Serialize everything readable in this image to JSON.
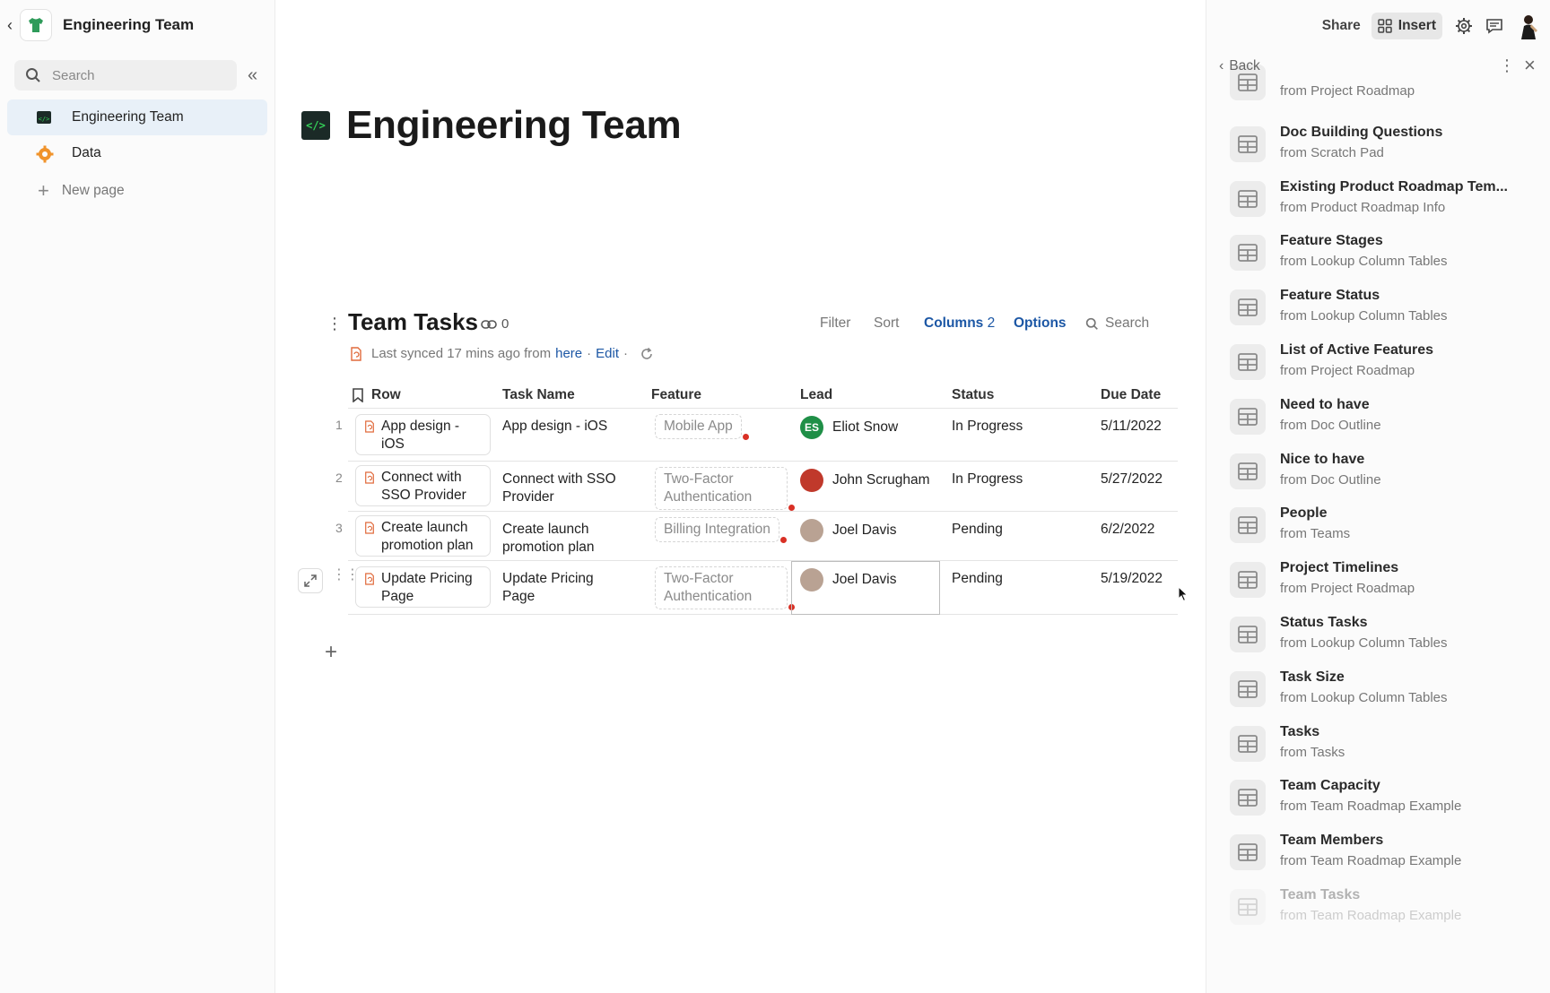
{
  "sidebar": {
    "workspace_title": "Engineering Team",
    "search_placeholder": "Search",
    "pages": [
      {
        "label": "Engineering Team",
        "icon": "code-terminal-icon",
        "active": true
      },
      {
        "label": "Data",
        "icon": "gear-icon",
        "active": false
      }
    ],
    "new_page_label": "New page"
  },
  "doc": {
    "title": "Engineering Team",
    "table": {
      "title": "Team Tasks",
      "link_count": "0",
      "toolbar": {
        "filter": "Filter",
        "sort": "Sort",
        "columns": "Columns",
        "columns_count": "2",
        "options": "Options",
        "search": "Search"
      },
      "sync": {
        "prefix": "Last synced 17 mins ago from",
        "here": "here",
        "edit": "Edit"
      },
      "columns": [
        "Row",
        "Task Name",
        "Feature",
        "Lead",
        "Status",
        "Due Date"
      ],
      "rows": [
        {
          "num": "1",
          "row": "App design - iOS",
          "task": "App design - iOS",
          "feature": "Mobile App",
          "lead": "Eliot Snow",
          "lead_initials": "ES",
          "status": "In Progress",
          "due": "5/11/2022"
        },
        {
          "num": "2",
          "row": "Connect with SSO Provider",
          "task": "Connect with SSO Provider",
          "feature": "Two-Factor Authentication",
          "lead": "John Scrugham",
          "lead_initials": "",
          "status": "In Progress",
          "due": "5/27/2022"
        },
        {
          "num": "3",
          "row": "Create launch promotion plan",
          "task": "Create launch promotion plan",
          "feature": "Billing Integration",
          "lead": "Joel Davis",
          "lead_initials": "",
          "status": "Pending",
          "due": "6/2/2022"
        },
        {
          "num": "4",
          "row": "Update Pricing Page",
          "task": "Update Pricing Page",
          "feature": "Two-Factor Authentication",
          "lead": "Joel Davis",
          "lead_initials": "",
          "status": "Pending",
          "due": "5/19/2022"
        }
      ]
    }
  },
  "topbar": {
    "share": "Share",
    "insert": "Insert"
  },
  "panel": {
    "back_label": "Back",
    "items": [
      {
        "name": "",
        "source": "from Project Roadmap"
      },
      {
        "name": "Doc Building Questions",
        "source": "from Scratch Pad"
      },
      {
        "name": "Existing Product Roadmap Tem...",
        "source": "from Product Roadmap Info"
      },
      {
        "name": "Feature Stages",
        "source": "from Lookup Column Tables"
      },
      {
        "name": "Feature Status",
        "source": "from Lookup Column Tables"
      },
      {
        "name": "List of Active Features",
        "source": "from Project Roadmap"
      },
      {
        "name": "Need to have",
        "source": "from Doc Outline"
      },
      {
        "name": "Nice to have",
        "source": "from Doc Outline"
      },
      {
        "name": "People",
        "source": "from Teams"
      },
      {
        "name": "Project Timelines",
        "source": "from Project Roadmap"
      },
      {
        "name": "Status Tasks",
        "source": "from Lookup Column Tables"
      },
      {
        "name": "Task Size",
        "source": "from Lookup Column Tables"
      },
      {
        "name": "Tasks",
        "source": "from Tasks"
      },
      {
        "name": "Team Capacity",
        "source": "from Team Roadmap Example"
      },
      {
        "name": "Team Members",
        "source": "from Team Roadmap Example"
      },
      {
        "name": "Team Tasks",
        "source": "from Team Roadmap Example"
      }
    ]
  },
  "colors": {
    "accent_blue": "#1c57a5",
    "active_page_bg": "#e8f0f8",
    "error_dot": "#d93025",
    "avatar_es": "#1f8f47"
  }
}
